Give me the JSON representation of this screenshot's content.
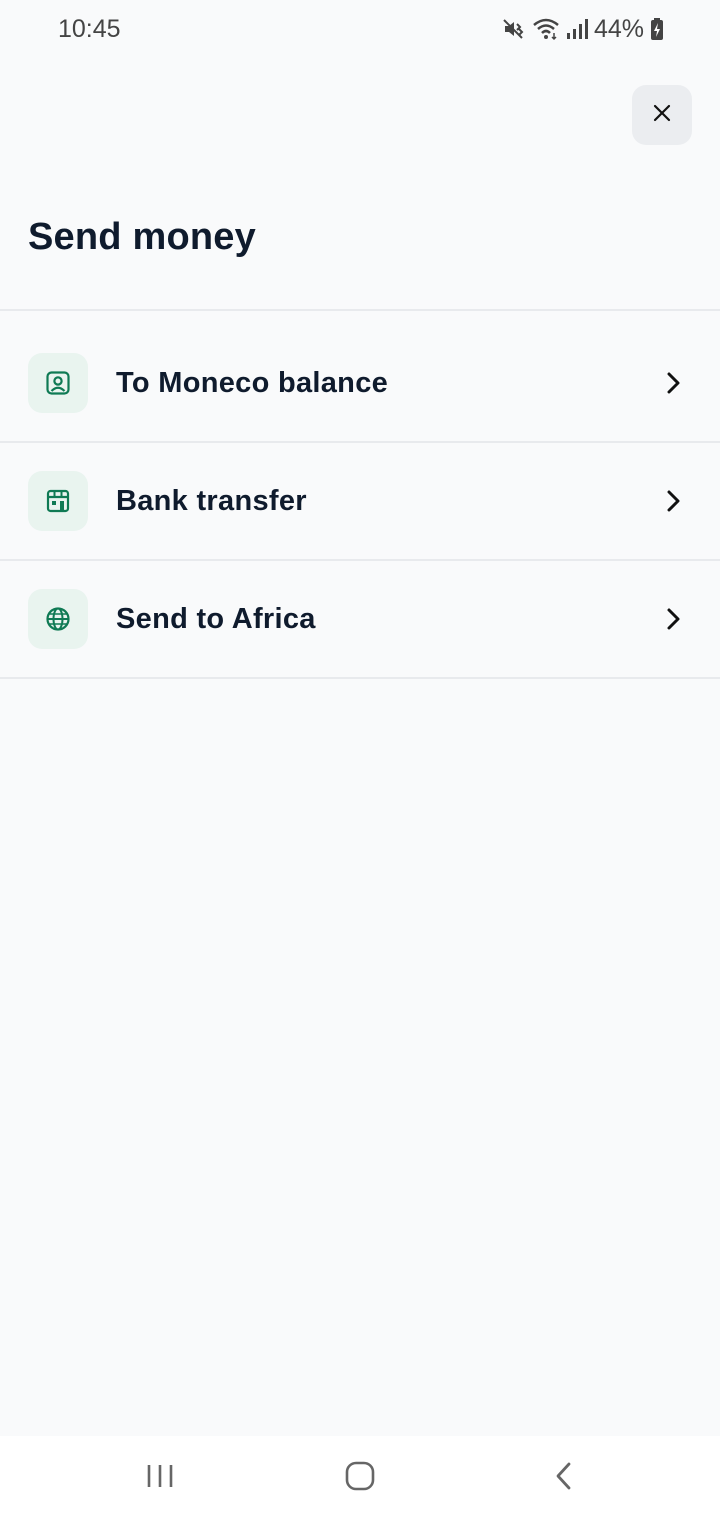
{
  "status_bar": {
    "time": "10:45",
    "battery_percent": "44%",
    "icons": [
      "mute-icon",
      "wifi-icon",
      "signal-icon",
      "battery-charging-icon"
    ]
  },
  "header": {
    "close_icon": "close-icon",
    "title": "Send money"
  },
  "options": [
    {
      "label": "To Moneco balance",
      "icon": "wallet-icon"
    },
    {
      "label": "Bank transfer",
      "icon": "bank-icon"
    },
    {
      "label": "Send to Africa",
      "icon": "globe-icon"
    }
  ],
  "nav_bar": {
    "icons": [
      "recent-apps-icon",
      "home-icon",
      "back-icon"
    ]
  },
  "colors": {
    "accent": "#0f7a54",
    "icon_bg": "#e9f4ef",
    "text": "#0f1b2d",
    "background": "#f9fafb"
  }
}
